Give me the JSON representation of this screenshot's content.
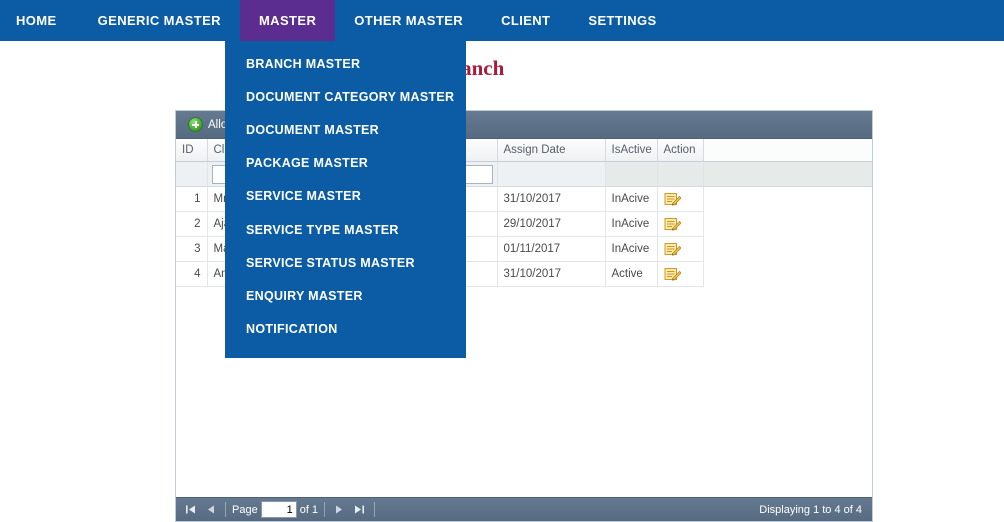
{
  "navbar": {
    "background_color": "#0b5ca5",
    "active_color": "#5b2d91",
    "items": [
      {
        "label": "HOME",
        "active": false
      },
      {
        "label": "GENERIC MASTER",
        "active": false
      },
      {
        "label": "MASTER",
        "active": true
      },
      {
        "label": "OTHER MASTER",
        "active": false
      },
      {
        "label": "CLIENT",
        "active": false
      },
      {
        "label": "SETTINGS",
        "active": false
      }
    ]
  },
  "dropdown": {
    "parent": "MASTER",
    "items": [
      {
        "label": "BRANCH MASTER"
      },
      {
        "label": "DOCUMENT CATEGORY MASTER"
      },
      {
        "label": "DOCUMENT MASTER"
      },
      {
        "label": "PACKAGE MASTER"
      },
      {
        "label": "SERVICE MASTER"
      },
      {
        "label": "SERVICE TYPE MASTER"
      },
      {
        "label": "SERVICE STATUS MASTER"
      },
      {
        "label": "ENQUIRY MASTER"
      },
      {
        "label": "NOTIFICATION"
      }
    ]
  },
  "page": {
    "title": "Assign Branch",
    "title_color": "#a81b3a"
  },
  "toolbar": {
    "allocate_label": "Allocate Branch",
    "plus_icon": "plus-circle-icon"
  },
  "grid": {
    "columns": [
      "ID",
      "Client Name",
      "Assign Date",
      "IsActive",
      "Action"
    ],
    "filter_values": [
      "",
      "",
      "",
      "",
      ""
    ],
    "filter_placeholder": "",
    "rows": [
      {
        "id": "1",
        "name": "Mr. Rahul Sharma",
        "assign_date": "31/10/2017",
        "is_active": "InAcive",
        "action_icon": "edit-icon"
      },
      {
        "id": "2",
        "name": "Ajay Enterprises",
        "assign_date": "29/10/2017",
        "is_active": "InAcive",
        "action_icon": "edit-icon"
      },
      {
        "id": "3",
        "name": "Mahesh Patel",
        "assign_date": "01/11/2017",
        "is_active": "InAcive",
        "action_icon": "edit-icon"
      },
      {
        "id": "4",
        "name": "Amit Kumar",
        "assign_date": "31/10/2017",
        "is_active": "Active",
        "action_icon": "edit-icon"
      }
    ]
  },
  "pager": {
    "first_icon": "first-page-icon",
    "prev_icon": "previous-page-icon",
    "page_label": "Page",
    "page_value": "1",
    "of_label": "of 1",
    "next_icon": "next-page-icon",
    "last_icon": "last-page-icon",
    "status": "Displaying 1 to 4 of 4"
  }
}
